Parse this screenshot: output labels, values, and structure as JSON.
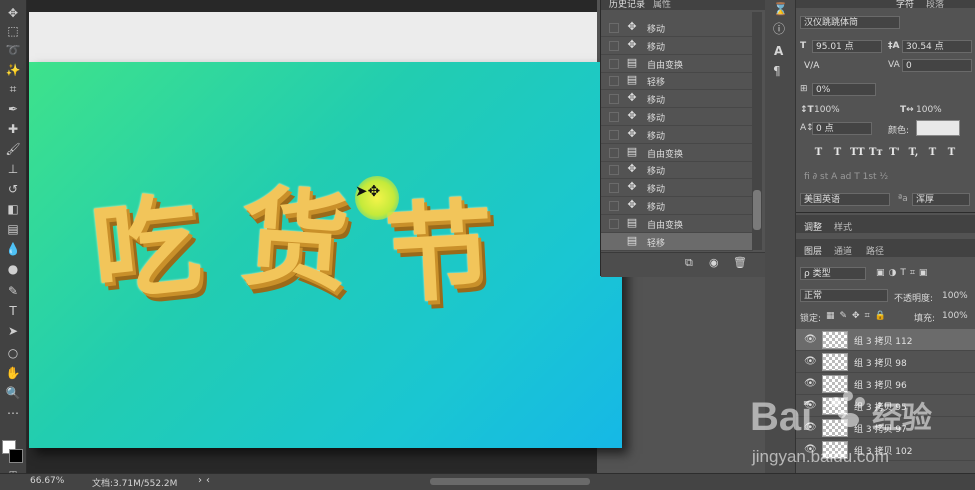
{
  "history": {
    "tabs": [
      "历史记录",
      "属性"
    ],
    "items": [
      {
        "label": "移动",
        "icon": "move-icon"
      },
      {
        "label": "移动",
        "icon": "move-icon"
      },
      {
        "label": "自由变换",
        "icon": "doc-icon"
      },
      {
        "label": "轻移",
        "icon": "doc-icon"
      },
      {
        "label": "移动",
        "icon": "move-icon"
      },
      {
        "label": "移动",
        "icon": "move-icon"
      },
      {
        "label": "移动",
        "icon": "move-icon"
      },
      {
        "label": "自由变换",
        "icon": "doc-icon"
      },
      {
        "label": "移动",
        "icon": "move-icon"
      },
      {
        "label": "移动",
        "icon": "move-icon"
      },
      {
        "label": "移动",
        "icon": "move-icon"
      },
      {
        "label": "自由变换",
        "icon": "doc-icon"
      },
      {
        "label": "轻移",
        "icon": "doc-icon"
      }
    ]
  },
  "canvas": {
    "text": [
      "吃",
      "货",
      "节"
    ],
    "gradient_colors": [
      "#3ee28b",
      "#16b8e6"
    ],
    "glyph_color": "#f2c55a"
  },
  "character": {
    "tab": "字符",
    "tab2": "段落",
    "font_family": "汉仪跳跳体简",
    "font_size": "95.01 点",
    "leading": "30.54 点",
    "kerning": "V/A",
    "tracking": "0",
    "scale_percent": "0%",
    "vertical_scale": "100%",
    "horizontal_scale": "100%",
    "baseline_shift": "0 点",
    "color_label": "颜色:",
    "color_value": "#e8e8e8",
    "style_buttons": [
      "T",
      "T",
      "TT",
      "Tт",
      "T'",
      "T,",
      "T",
      "T"
    ],
    "language": "美国英语",
    "antialias": "浑厚"
  },
  "adjustments": {
    "tabs": [
      "调整",
      "样式"
    ]
  },
  "layers": {
    "tabs": [
      "图层",
      "通道",
      "路径"
    ],
    "filter": "ρ 类型",
    "blend_mode": "正常",
    "opacity_label": "不透明度:",
    "opacity": "100%",
    "lock_label": "锁定:",
    "fill_label": "填充:",
    "fill": "100%",
    "items": [
      {
        "name": "组 3 拷贝 112",
        "selected": true
      },
      {
        "name": "组 3 拷贝 98",
        "selected": false
      },
      {
        "name": "组 3 拷贝 96",
        "selected": false
      },
      {
        "name": "组 3 拷贝 95",
        "selected": false
      },
      {
        "name": "组 3 拷贝 97",
        "selected": false
      },
      {
        "name": "组 3 拷贝 102",
        "selected": false
      }
    ]
  },
  "status": {
    "zoom": "66.67%",
    "doc": "文档:3.71M/552.2M"
  },
  "watermark": {
    "brand": "Bai",
    "brand2": "经验",
    "url": "jingyan.baidu.com"
  }
}
